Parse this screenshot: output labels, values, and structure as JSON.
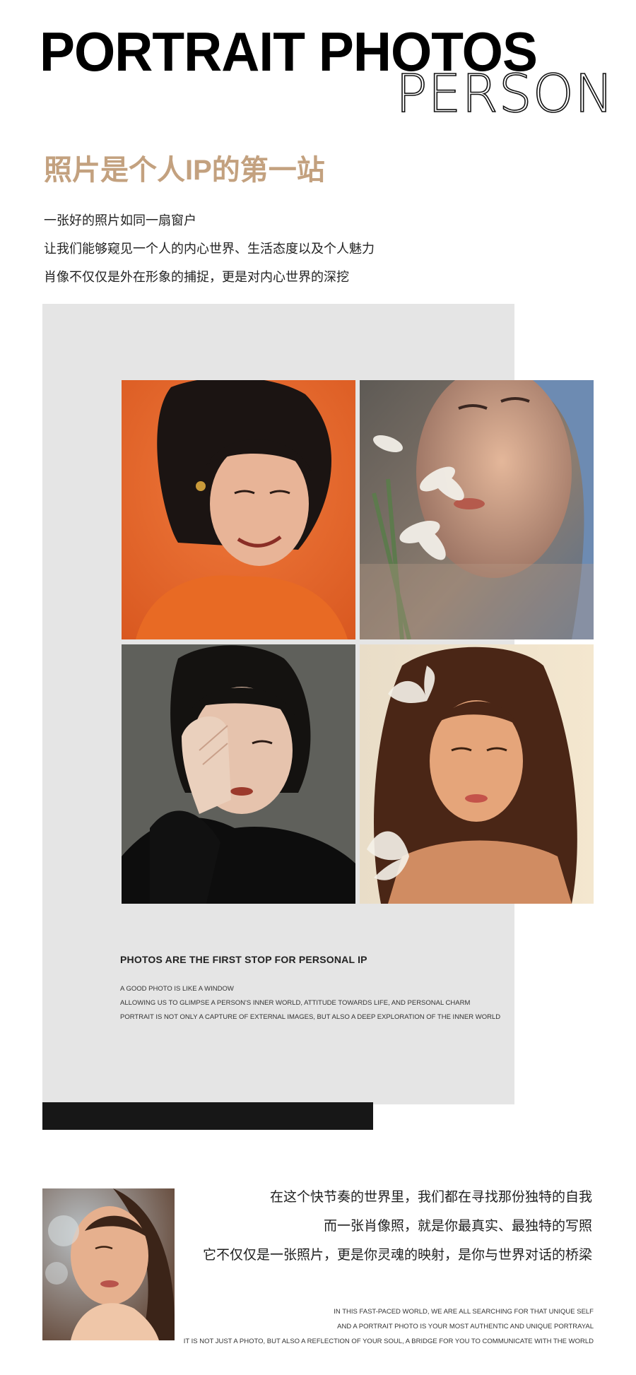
{
  "header": {
    "title": "PORTRAIT PHOTOS",
    "subtitle": "PERSON"
  },
  "headline": "照片是个人IP的第一站",
  "intro": [
    "一张好的照片如同一扇窗户",
    "让我们能够窥见一个人的内心世界、生活态度以及个人魅力",
    "肖像不仅仅是外在形象的捕捉，更是对内心世界的深挖"
  ],
  "english_block": {
    "heading": "PHOTOS ARE THE FIRST STOP FOR PERSONAL IP",
    "lines": [
      "A GOOD PHOTO IS LIKE A WINDOW",
      "ALLOWING US TO GLIMPSE A PERSON'S INNER WORLD, ATTITUDE TOWARDS LIFE, AND PERSONAL CHARM",
      "PORTRAIT IS NOT ONLY A CAPTURE OF EXTERNAL IMAGES, BUT ALSO A DEEP EXPLORATION OF THE INNER WORLD"
    ]
  },
  "closing": {
    "chinese_lines": [
      "在这个快节奏的世界里，我们都在寻找那份独特的自我",
      "而一张肖像照，就是你最真实、最独特的写照",
      "它不仅仅是一张照片，更是你灵魂的映射，是你与世界对话的桥梁"
    ],
    "english_lines": [
      "IN THIS FAST-PACED WORLD, WE ARE ALL SEARCHING FOR THAT UNIQUE SELF",
      "AND A PORTRAIT PHOTO IS YOUR MOST AUTHENTIC AND UNIQUE PORTRAYAL",
      "IT IS NOT JUST A PHOTO, BUT ALSO A REFLECTION OF YOUR SOUL, A BRIDGE FOR YOU TO COMMUNICATE WITH THE WORLD"
    ]
  },
  "colors": {
    "accent": "#c3a17f",
    "panel": "#e5e5e5",
    "bar": "#171717"
  }
}
